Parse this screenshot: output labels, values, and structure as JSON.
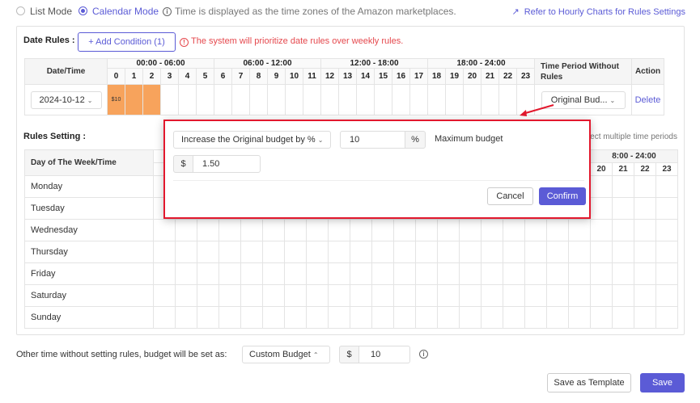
{
  "top": {
    "list_mode": "List Mode",
    "calendar_mode": "Calendar Mode",
    "timezone_note": "Time is displayed as the time zones of the Amazon marketplaces.",
    "hourly_link": "Refer to Hourly Charts for Rules Settings",
    "info_glyph": "i",
    "trend_glyph": "↗"
  },
  "date_rules": {
    "label": "Date Rules :",
    "add_condition": "+ Add Condition (1)",
    "warning": "The system will prioritize date rules over weekly rules.",
    "warning_glyph": "!",
    "col_date": "Date/Time",
    "col_no_rules": "Time Period Without Rules",
    "col_action": "Action",
    "ranges": [
      "00:00 - 06:00",
      "06:00 - 12:00",
      "12:00 - 18:00",
      "18:00 - 24:00"
    ],
    "hours": [
      "0",
      "1",
      "2",
      "3",
      "4",
      "5",
      "6",
      "7",
      "8",
      "9",
      "10",
      "11",
      "12",
      "13",
      "14",
      "15",
      "16",
      "17",
      "18",
      "19",
      "20",
      "21",
      "22",
      "23"
    ],
    "row": {
      "date": "2024-10-12",
      "cell_label": "$10",
      "highlighted_hours": [
        0,
        1,
        2
      ],
      "budget_option": "Original Bud...",
      "action": "Delete"
    }
  },
  "rules_setting": {
    "label": "Rules Setting :",
    "hint": "ect multiple time periods",
    "col_day": "Day of The Week/Time",
    "visible_range": "8:00 - 24:00",
    "visible_hours": [
      "20",
      "21",
      "22",
      "23"
    ],
    "days": [
      "Monday",
      "Tuesday",
      "Wednesday",
      "Thursday",
      "Friday",
      "Saturday",
      "Sunday"
    ]
  },
  "popup": {
    "mode_select": "Increase the Original budget by %",
    "percent_value": "10",
    "percent_unit": "%",
    "max_label": "Maximum budget",
    "currency": "$",
    "max_value": "1.50",
    "cancel": "Cancel",
    "confirm": "Confirm"
  },
  "bottom": {
    "other_time_text": "Other time without setting rules, budget will be set as:",
    "budget_mode": "Custom Budget",
    "currency": "$",
    "amount": "10",
    "save_template": "Save as Template",
    "save": "Save"
  },
  "colors": {
    "accent": "#5b5bd6",
    "highlight": "#f7a35c",
    "alert": "#e2182d"
  }
}
